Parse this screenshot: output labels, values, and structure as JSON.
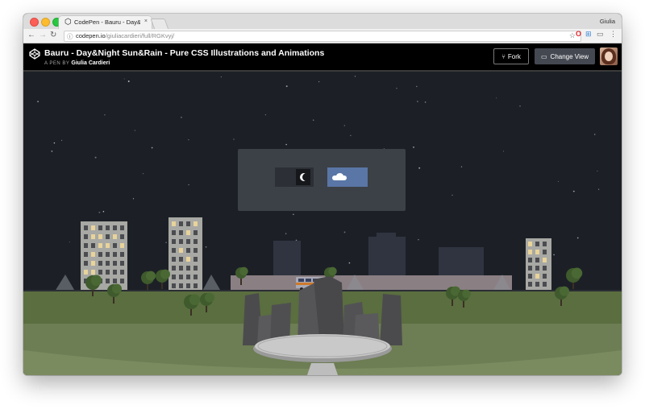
{
  "browser": {
    "tab_title": "CodePen - Bauru - Day&Night",
    "tab_close": "×",
    "profile_name": "Giulia",
    "url_host": "codepen.io",
    "url_path": "/giuliacardieri/full/RGKvyj/"
  },
  "header": {
    "pen_title": "Bauru - Day&Night Sun&Rain - Pure CSS Illustrations and Animations",
    "byline_prefix": "A PEN BY",
    "author": "Giulia Cardieri",
    "fork_label": "Fork",
    "change_view_label": "Change View"
  },
  "scene": {
    "mode": "night",
    "toggle_options": [
      "night",
      "rain"
    ],
    "colors": {
      "sky": "#1c2026",
      "grass": "#5a6e3f",
      "grass_far": "#47592f",
      "plaza": "#6d7d54",
      "building_light": "#a8a8a4",
      "window_lit": "#e8d39a",
      "rain_button": "#5a76a6",
      "panel": "#3c4047"
    },
    "icons": [
      "codepen-logo-icon",
      "fork-icon",
      "change-view-icon",
      "moon-icon",
      "cloud-icon",
      "bus-icon"
    ]
  }
}
